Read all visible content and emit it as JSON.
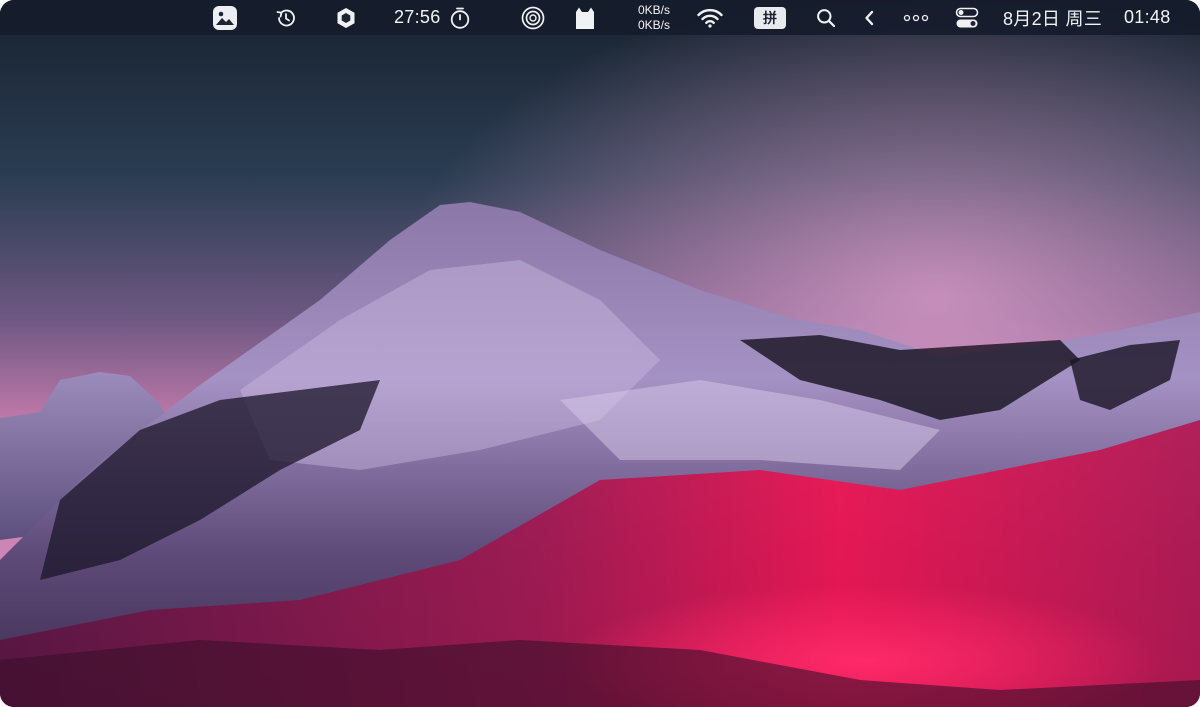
{
  "menubar": {
    "icons": {
      "photo": "photo-icon",
      "history": "history-icon",
      "shield": "hexagon-shield-icon",
      "timer": "stopwatch-icon",
      "rings": "circle-rings-icon",
      "cat": "cat-icon",
      "wifi": "wifi-icon",
      "search": "search-icon",
      "chevron": "chevron-left-icon",
      "more": "more-dots-icon",
      "control_center": "control-center-icon"
    },
    "timer_value": "27:56",
    "network": {
      "upload": "0KB/s",
      "download": "0KB/s"
    },
    "input_method": "拼",
    "date": "8月2日 周三",
    "time": "01:48"
  },
  "wallpaper": {
    "description_colors": {
      "sky_top": "#1f3142",
      "sky_horizon": "#c07aa8",
      "mountain_snow": "#b7a3cf",
      "trees": "#1a1628",
      "foliage": "#e0104a"
    }
  }
}
